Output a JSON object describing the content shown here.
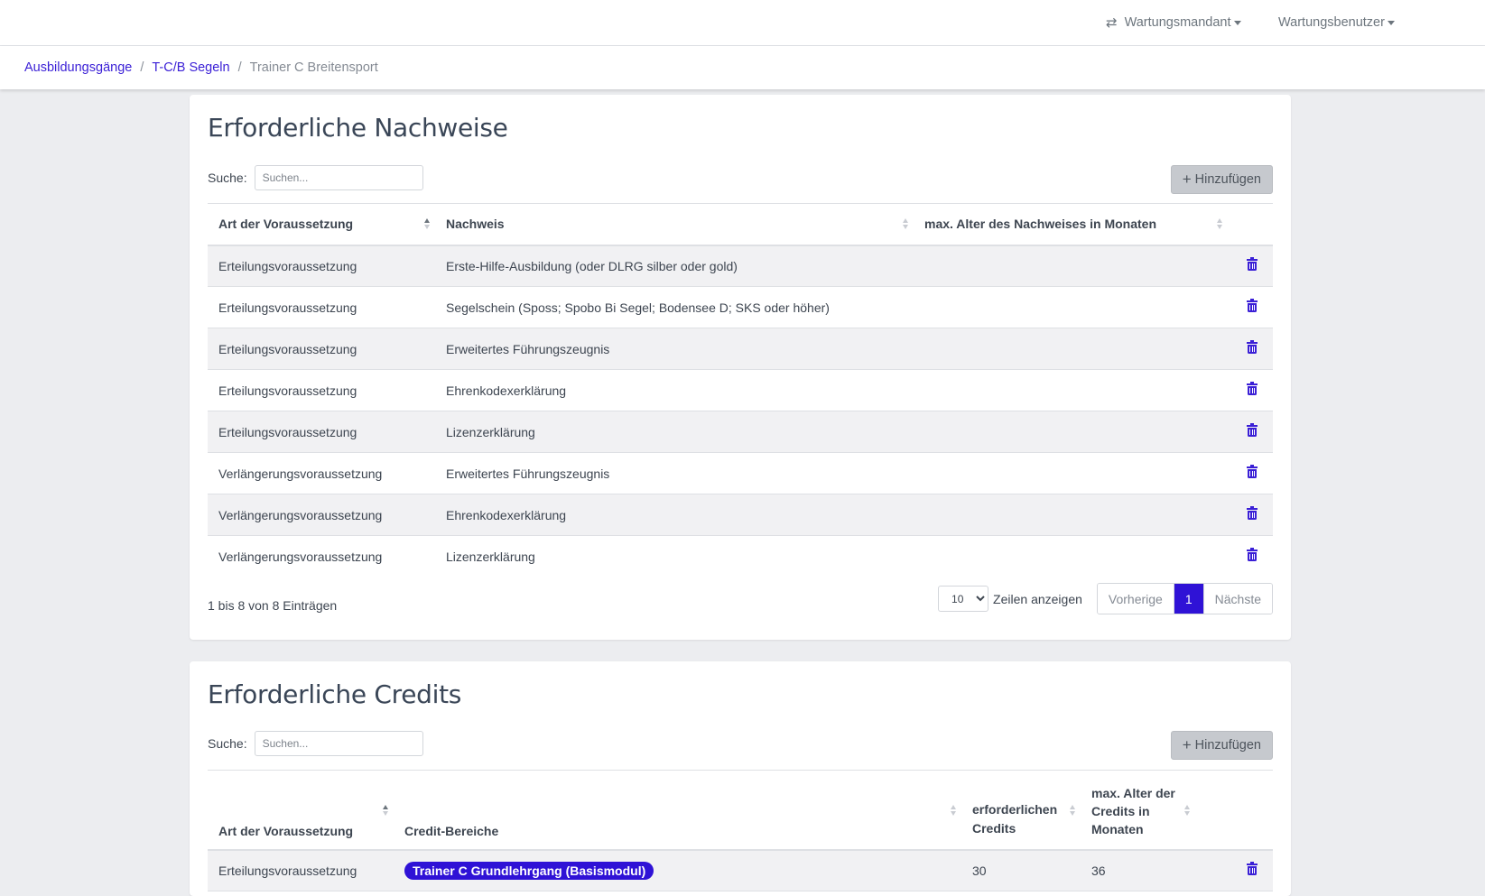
{
  "topbar": {
    "tenant_label": "Wartungsmandant",
    "user_label": "Wartungsbenutzer"
  },
  "breadcrumb": {
    "items": [
      "Ausbildungsgänge",
      "T-C/B Segeln"
    ],
    "current": "Trainer C Breitensport"
  },
  "nachweise": {
    "title": "Erforderliche Nachweise",
    "search_label": "Suche:",
    "search_placeholder": "Suchen...",
    "add_label": "Hinzufügen",
    "columns": [
      "Art der Voraussetzung",
      "Nachweis",
      "max. Alter des Nachweises in Monaten"
    ],
    "rows": [
      {
        "art": "Erteilungsvoraussetzung",
        "nachweis": "Erste-Hilfe-Ausbildung (oder DLRG silber oder gold)",
        "alter": ""
      },
      {
        "art": "Erteilungsvoraussetzung",
        "nachweis": "Segelschein (Sposs; Spobo Bi Segel; Bodensee D; SKS oder höher)",
        "alter": ""
      },
      {
        "art": "Erteilungsvoraussetzung",
        "nachweis": "Erweitertes Führungszeugnis",
        "alter": ""
      },
      {
        "art": "Erteilungsvoraussetzung",
        "nachweis": "Ehrenkodexerklärung",
        "alter": ""
      },
      {
        "art": "Erteilungsvoraussetzung",
        "nachweis": "Lizenzerklärung",
        "alter": ""
      },
      {
        "art": "Verlängerungsvoraussetzung",
        "nachweis": "Erweitertes Führungszeugnis",
        "alter": ""
      },
      {
        "art": "Verlängerungsvoraussetzung",
        "nachweis": "Ehrenkodexerklärung",
        "alter": ""
      },
      {
        "art": "Verlängerungsvoraussetzung",
        "nachweis": "Lizenzerklärung",
        "alter": ""
      }
    ],
    "info": "1 bis 8 von 8 Einträgen",
    "page_size": "10",
    "rows_label": "Zeilen anzeigen",
    "prev_label": "Vorherige",
    "current_page": "1",
    "next_label": "Nächste"
  },
  "credits": {
    "title": "Erforderliche Credits",
    "search_label": "Suche:",
    "search_placeholder": "Suchen...",
    "add_label": "Hinzufügen",
    "columns": [
      "Art der Voraussetzung",
      "Credit-Bereiche",
      "erforderlichen Credits",
      "max. Alter der Credits in Monaten"
    ],
    "rows": [
      {
        "art": "Erteilungsvoraussetzung",
        "bereich": "Trainer C Grundlehrgang (Basismodul)",
        "credits": "30",
        "alter": "36"
      }
    ]
  },
  "colors": {
    "accent": "#2f12d6",
    "link": "#3a1fd6",
    "background": "#ecedf0"
  }
}
